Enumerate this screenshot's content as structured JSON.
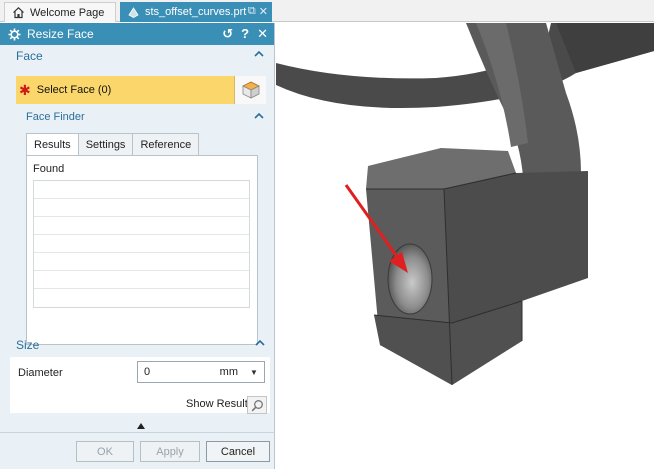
{
  "tabs": [
    {
      "label": "Welcome Page",
      "icon": "home-icon"
    },
    {
      "label": "sts_offset_curves.prt",
      "icon": "part-file-icon",
      "active": true
    }
  ],
  "dialog": {
    "title": "Resize Face",
    "title_buttons": {
      "reset": "↺",
      "help": "?",
      "close": "✕"
    },
    "face_section": {
      "header": "Face",
      "select_label": "Select Face (0)",
      "required_marker": "✱",
      "face_finder": {
        "header": "Face Finder",
        "tabs": [
          "Results",
          "Settings",
          "Reference"
        ],
        "active_tab": "Results",
        "found_label": "Found",
        "found_rows": [
          "",
          "",
          "",
          "",
          "",
          "",
          ""
        ]
      }
    },
    "size_section": {
      "header": "Size",
      "diameter_label": "Diameter",
      "diameter_value": "0",
      "unit": "mm"
    },
    "show_result_label": "Show Result",
    "buttons": {
      "ok": "OK",
      "apply": "Apply",
      "cancel": "Cancel"
    }
  },
  "colors": {
    "titlebar": "#3a8fb7",
    "select_highlight": "#fbd76b",
    "section_text": "#2a6f99",
    "arrow": "#e02020",
    "model": "#555555"
  }
}
